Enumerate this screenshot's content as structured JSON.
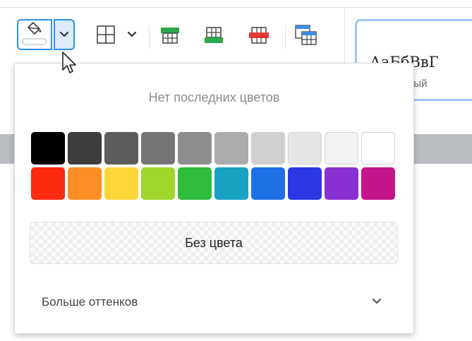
{
  "toolbar": {
    "fill_button": {
      "icon": "paint-bucket-icon",
      "arrow_icon": "chevron-down-icon"
    },
    "borders_button": {
      "icon": "borders-icon",
      "arrow_icon": "chevron-down-icon"
    },
    "insert_row_above": {
      "icon": "table-insert-green-icon"
    },
    "insert_row_below": {
      "icon": "table-insert-green-icon"
    },
    "delete_row": {
      "icon": "table-delete-red-icon"
    },
    "cell_format": {
      "icon": "table-format-blue-icon"
    },
    "colors": {
      "accent": "#2c8fe8",
      "green": "#2aa84a",
      "red": "#e53935",
      "blue": "#3b8de0"
    }
  },
  "style_preview": {
    "sample": "АаБбВвГ",
    "label": "ный"
  },
  "color_popup": {
    "recent_text": "Нет последних цветов",
    "palette": [
      [
        "#000000",
        "#3d3d3d",
        "#5c5c5c",
        "#757575",
        "#8e8e8e",
        "#ababab",
        "#cfcfcf",
        "#e6e6e6",
        "#f2f2f2",
        "#ffffff"
      ],
      [
        "#fc2a0f",
        "#fd8e25",
        "#fed63a",
        "#a0d72b",
        "#2fbb3b",
        "#19a2c2",
        "#1f70e6",
        "#2b38e4",
        "#8a2fd0",
        "#c4168a"
      ]
    ],
    "no_color_label": "Без цвета",
    "more_shades_label": "Больше оттенков",
    "more_shades_icon": "chevron-down-icon"
  }
}
